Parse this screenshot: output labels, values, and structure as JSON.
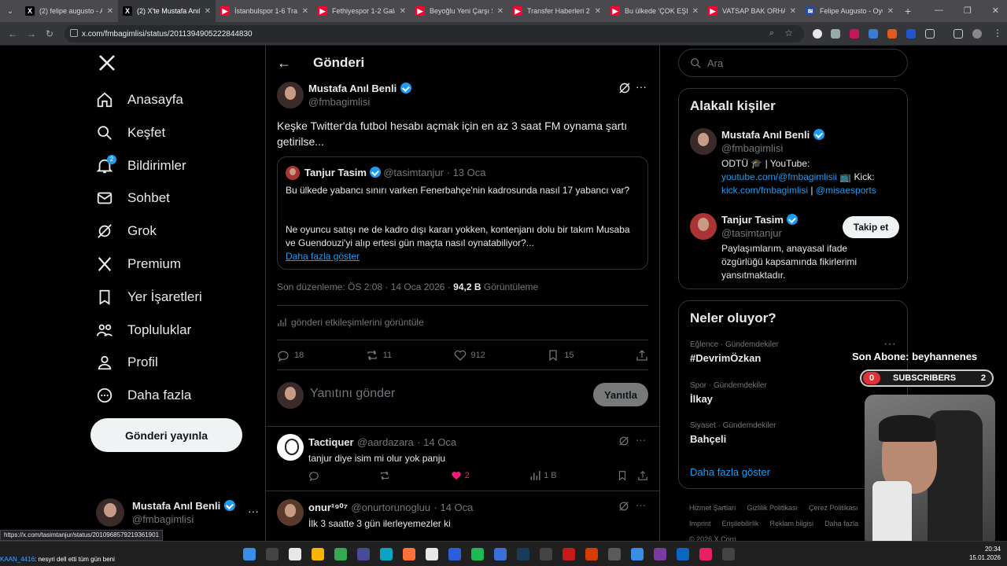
{
  "browser": {
    "tabs": [
      {
        "title": "(2) felipe augusto - A",
        "fav": "X",
        "color": "#000000"
      },
      {
        "title": "(2) X'te Mustafa Anıl",
        "fav": "X",
        "color": "#000000"
      },
      {
        "title": "İstanbulspor 1-6 Trab",
        "fav": "▶",
        "color": "#ff0033"
      },
      {
        "title": "Fethiyespor 1-2 Galat",
        "fav": "▶",
        "color": "#ff0033"
      },
      {
        "title": "Beyoğlu Yeni Çarşı Sp",
        "fav": "▶",
        "color": "#ff0033"
      },
      {
        "title": "Transfer Haberleri 20",
        "fav": "▶",
        "color": "#ff0033"
      },
      {
        "title": "Bu ülkede 'ÇOK EŞLİL",
        "fav": "▶",
        "color": "#ff0033"
      },
      {
        "title": "VATSAP BAK ORHAN",
        "fav": "▶",
        "color": "#ff0033"
      },
      {
        "title": "Felipe Augusto - Oyu",
        "fav": "≋",
        "color": "#2a4a9a"
      }
    ],
    "url": "x.com/fmbagimlisi/status/2011394905222844830",
    "status_url": "https://x.com/tasimtanjur/status/2010968579219361901"
  },
  "nav": {
    "items": [
      {
        "label": "Anasayfa",
        "icon": "home-icon"
      },
      {
        "label": "Keşfet",
        "icon": "search-icon"
      },
      {
        "label": "Bildirimler",
        "icon": "bell-icon",
        "badge": "2"
      },
      {
        "label": "Sohbet",
        "icon": "mail-icon"
      },
      {
        "label": "Grok",
        "icon": "grok-icon"
      },
      {
        "label": "Premium",
        "icon": "x-logo-icon"
      },
      {
        "label": "Yer İşaretleri",
        "icon": "bookmark-icon"
      },
      {
        "label": "Topluluklar",
        "icon": "people-icon"
      },
      {
        "label": "Profil",
        "icon": "person-icon"
      },
      {
        "label": "Daha fazla",
        "icon": "more-circle-icon"
      }
    ],
    "post_button": "Gönderi yayınla",
    "account": {
      "name": "Mustafa Anıl Benli",
      "handle": "@fmbagimlisi"
    }
  },
  "post": {
    "header_title": "Gönderi",
    "author": {
      "name": "Mustafa Anıl Benli",
      "handle": "@fmbagimlisi"
    },
    "text": "Keşke Twitter'da futbol hesabı açmak için en az 3 saat FM oynama şartı getirilse...",
    "quote": {
      "name": "Tanjur Tasim",
      "handle": "@tasimtanjur",
      "date": "· 13 Oca",
      "p1": "Bu ülkede yabancı sınırı varken Fenerbahçe'nin kadrosunda nasıl 17 yabancı var?",
      "p2": "Ne oyuncu satışı ne de kadro dışı kararı yokken, kontenjanı dolu bir takım Musaba ve Guendouzi'yi alıp ertesi gün maçta nasıl oynatabiliyor?...",
      "more": "Daha fazla göster"
    },
    "meta_prefix": "Son düzenleme: ÖS 2:08 · 14 Oca 2026 ·",
    "views": "94,2 B",
    "views_label": "Görüntüleme",
    "engagements": "gönderi etkileşimlerini görüntüle",
    "stats": {
      "replies": "18",
      "reposts": "11",
      "likes": "912",
      "bookmarks": "15"
    },
    "reply_placeholder": "Yanıtını gönder",
    "reply_button": "Yanıtla"
  },
  "replies": [
    {
      "name": "Tactiquer",
      "handle": "@aardazara",
      "date": "· 14 Oca",
      "text": "tanjur diye isim mi olur yok panju",
      "likes": "2",
      "views": "1 B"
    },
    {
      "name": "onur¹⁹⁰⁷",
      "handle": "@onurtorunogluu",
      "date": "· 14 Oca",
      "text": "İlk 3 saatte 3 gün ilerleyemezler ki"
    }
  ],
  "sidebar": {
    "search_placeholder": "Ara",
    "relevant_title": "Alakalı kişiler",
    "people": [
      {
        "name": "Mustafa Anıl Benli",
        "handle": "@fmbagimlisi",
        "bio1": "ODTÜ 🎓 | YouTube:",
        "bio_link1": "youtube.com/@fmbagimlisii",
        "bio2": "📺 Kick:",
        "bio_link2": "kick.com/fmbagimlisi",
        "bio3": "|",
        "bio_link3": "@misaesports"
      },
      {
        "name": "Tanjur Tasim",
        "handle": "@tasimtanjur",
        "bio": "Paylaşımlarım, anayasal ifade özgürlüğü kapsamında fikirlerimi yansıtmaktadır.",
        "follow": "Takip et"
      }
    ],
    "trends_title": "Neler oluyor?",
    "trends": [
      {
        "cat": "Eğlence · Gündemdekiler",
        "name": "#DevrimÖzkan"
      },
      {
        "cat": "Spor · Gündemdekiler",
        "name": "İlkay"
      },
      {
        "cat": "Siyaset · Gündemdekiler",
        "name": "Bahçeli"
      }
    ],
    "trends_more": "Daha fazla göster",
    "footer": [
      "Hizmet Şartları",
      "Gizlilik Politikası",
      "Çerez Politikası",
      "Imprint",
      "Erişilebilirlik",
      "Reklam bilgisi",
      "Daha fazla",
      "© 2026 X Corp."
    ]
  },
  "stream": {
    "last_sub": "Son Abone: beyhannenes",
    "subs_count": "0",
    "subs_label": "SUBSCRIBERS",
    "subs_right": "2",
    "ticker_user": "KAAN_4416",
    "ticker_text": ": nesyri dell etti tüm gün beni"
  },
  "taskbar": {
    "time": "20:34",
    "date": "15.01.2026"
  }
}
